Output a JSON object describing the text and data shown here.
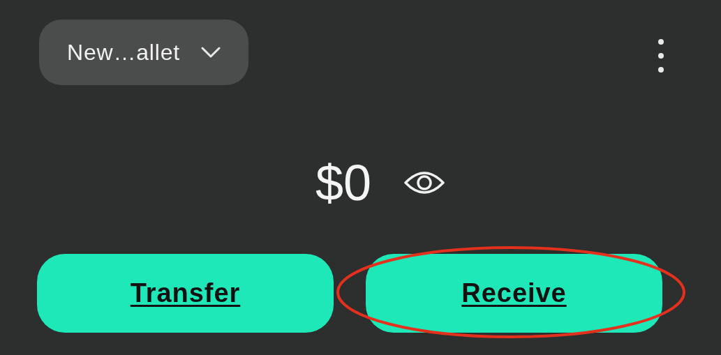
{
  "wallet_selector": {
    "label": "New…allet"
  },
  "balance": {
    "amount": "$0"
  },
  "actions": [
    {
      "label": "Transfer",
      "highlighted": false
    },
    {
      "label": "Receive",
      "highlighted": true
    }
  ]
}
